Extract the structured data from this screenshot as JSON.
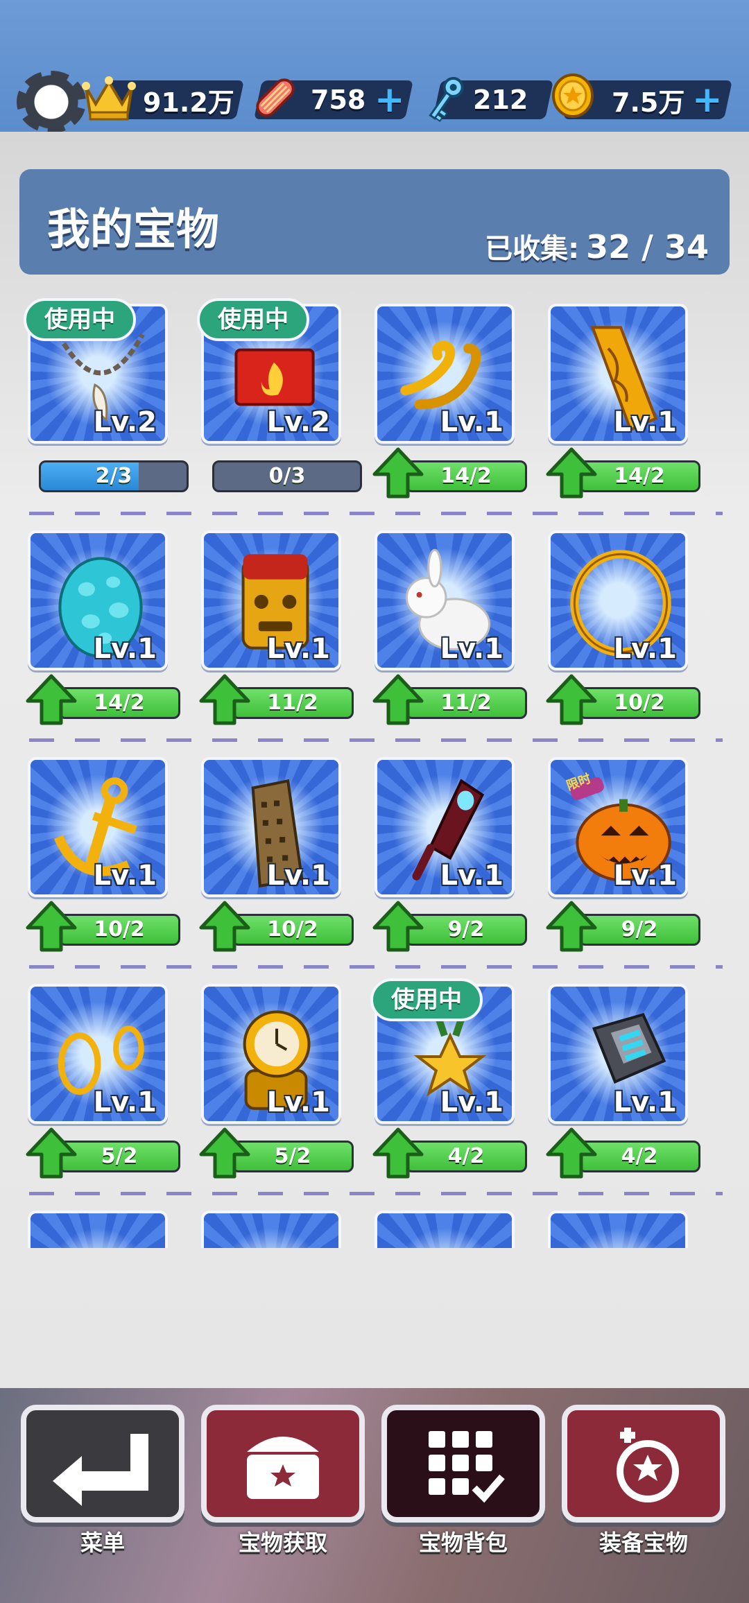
{
  "currencies": [
    {
      "icon": "crown-icon",
      "value": "91.2万",
      "plus": false
    },
    {
      "icon": "hoverboard-icon",
      "value": "758",
      "plus": true
    },
    {
      "icon": "key-icon",
      "value": "212",
      "plus": false
    },
    {
      "icon": "coin-icon",
      "value": "7.5万",
      "plus": true
    }
  ],
  "header": {
    "title": "我的宝物",
    "collected_label": "已收集:",
    "collected_value": "32 / 34"
  },
  "badge_text": "使用中",
  "items": [
    {
      "name": "tooth-necklace",
      "level": "Lv.2",
      "progress": "2/3",
      "in_use": true,
      "upgradable": false,
      "fill": 0.67
    },
    {
      "name": "fire-box",
      "level": "Lv.2",
      "progress": "0/3",
      "in_use": true,
      "upgradable": false,
      "fill": 0
    },
    {
      "name": "golden-shoes",
      "level": "Lv.1",
      "progress": "14/2",
      "in_use": false,
      "upgradable": true
    },
    {
      "name": "golden-bar",
      "level": "Lv.1",
      "progress": "14/2",
      "in_use": false,
      "upgradable": true
    },
    {
      "name": "spotted-egg",
      "level": "Lv.1",
      "progress": "14/2",
      "in_use": false,
      "upgradable": true
    },
    {
      "name": "tiki-totem",
      "level": "Lv.1",
      "progress": "11/2",
      "in_use": false,
      "upgradable": true
    },
    {
      "name": "white-rabbit",
      "level": "Lv.1",
      "progress": "11/2",
      "in_use": false,
      "upgradable": true
    },
    {
      "name": "golden-ring",
      "level": "Lv.1",
      "progress": "10/2",
      "in_use": false,
      "upgradable": true
    },
    {
      "name": "anchor",
      "level": "Lv.1",
      "progress": "10/2",
      "in_use": false,
      "upgradable": true
    },
    {
      "name": "skyscraper",
      "level": "Lv.1",
      "progress": "10/2",
      "in_use": false,
      "upgradable": true
    },
    {
      "name": "ghost-lantern",
      "level": "Lv.1",
      "progress": "9/2",
      "in_use": false,
      "upgradable": true
    },
    {
      "name": "pumpkin",
      "level": "Lv.1",
      "progress": "9/2",
      "in_use": false,
      "upgradable": true,
      "tag": "限时"
    },
    {
      "name": "gold-earrings",
      "level": "Lv.1",
      "progress": "5/2",
      "in_use": false,
      "upgradable": true
    },
    {
      "name": "gold-watch",
      "level": "Lv.1",
      "progress": "5/2",
      "in_use": false,
      "upgradable": true
    },
    {
      "name": "star-medal",
      "level": "Lv.1",
      "progress": "4/2",
      "in_use": true,
      "upgradable": true
    },
    {
      "name": "digital-watch",
      "level": "Lv.1",
      "progress": "4/2",
      "in_use": false,
      "upgradable": true
    }
  ],
  "bottom_nav": [
    {
      "label": "菜单",
      "icon": "return-arrow-icon",
      "color": "#3b3b3f"
    },
    {
      "label": "宝物获取",
      "icon": "treasure-chest-icon",
      "color": "#8c2a3a"
    },
    {
      "label": "宝物背包",
      "icon": "grid-check-icon",
      "color": "#2a0f18"
    },
    {
      "label": "装备宝物",
      "icon": "equip-medal-icon",
      "color": "#8c2a3a"
    }
  ]
}
